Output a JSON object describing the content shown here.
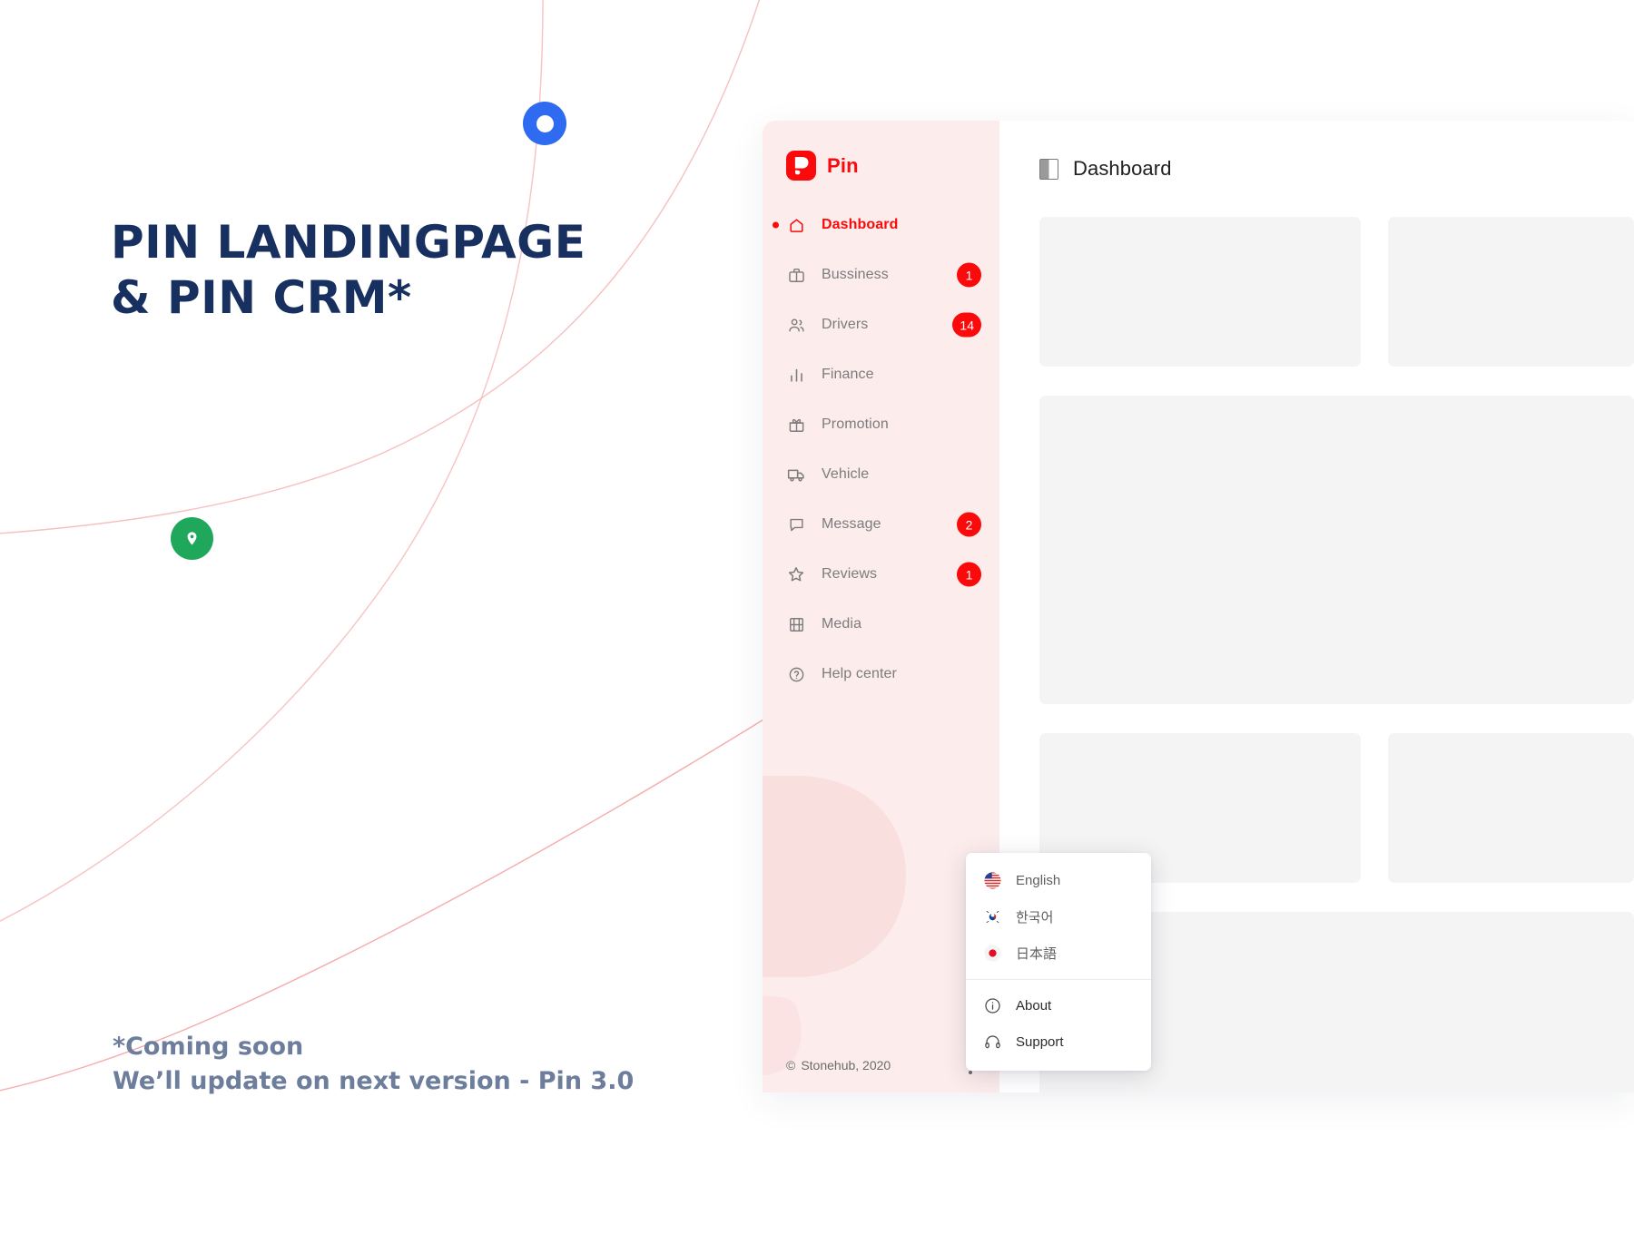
{
  "promo": {
    "headline_line1": "PIN LANDINGPAGE",
    "headline_line2": "& PIN CRM*",
    "note_line1": "*Coming soon",
    "note_line2": "We’ll update on next version - Pin 3.0"
  },
  "colors": {
    "brand_red": "#FA0A0A",
    "sidebar_bg": "#FCECEC",
    "headline_navy": "#17305F",
    "note_slate": "#6D7D9C",
    "marker_blue": "#2F6BF0",
    "marker_green": "#1FA85C",
    "skeleton_gray": "#F4F4F4"
  },
  "sidebar": {
    "brand": {
      "name": "Pin",
      "mark_icon": "pin-logo-icon"
    },
    "items": [
      {
        "label": "Dashboard",
        "icon": "home-icon",
        "badge": "",
        "active": true
      },
      {
        "label": "Bussiness",
        "icon": "briefcase-icon",
        "badge": "1",
        "active": false
      },
      {
        "label": "Drivers",
        "icon": "users-icon",
        "badge": "14",
        "active": false
      },
      {
        "label": "Finance",
        "icon": "bar-chart-icon",
        "badge": "",
        "active": false
      },
      {
        "label": "Promotion",
        "icon": "gift-icon",
        "badge": "",
        "active": false
      },
      {
        "label": "Vehicle",
        "icon": "truck-icon",
        "badge": "",
        "active": false
      },
      {
        "label": "Message",
        "icon": "chat-icon",
        "badge": "2",
        "active": false
      },
      {
        "label": "Reviews",
        "icon": "star-icon",
        "badge": "1",
        "active": false
      },
      {
        "label": "Media",
        "icon": "film-icon",
        "badge": "",
        "active": false
      },
      {
        "label": "Help center",
        "icon": "question-circle-icon",
        "badge": "",
        "active": false
      }
    ],
    "footer": {
      "copyright_symbol": "©",
      "copyright": "Stonehub, 2020",
      "menu_icon": "kebab-menu-icon"
    }
  },
  "main": {
    "toggle_icon": "sidebar-toggle-icon",
    "title": "Dashboard"
  },
  "dropdown": {
    "languages": [
      {
        "label": "English",
        "flag": "flag-us-icon"
      },
      {
        "label": "한국어",
        "flag": "flag-kr-icon"
      },
      {
        "label": "日本語",
        "flag": "flag-jp-icon"
      }
    ],
    "actions": [
      {
        "label": "About",
        "icon": "info-circle-icon"
      },
      {
        "label": "Support",
        "icon": "headset-icon"
      }
    ]
  },
  "markers": [
    {
      "name": "blue-dot-marker",
      "icon": "circle-donut-icon"
    },
    {
      "name": "green-pin-marker",
      "icon": "map-pin-icon"
    }
  ]
}
